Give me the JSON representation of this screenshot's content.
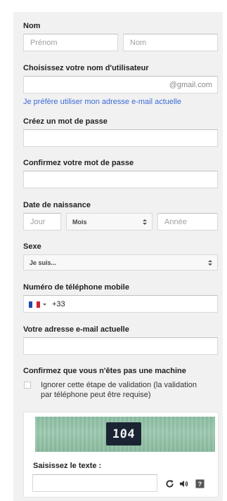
{
  "name": {
    "label": "Nom",
    "first_placeholder": "Prénom",
    "last_placeholder": "Nom"
  },
  "username": {
    "label": "Choisissez votre nom d'utilisateur",
    "suffix": "@gmail.com",
    "alt_link": "Je préfère utiliser mon adresse e-mail actuelle"
  },
  "password": {
    "label": "Créez un mot de passe"
  },
  "confirm_password": {
    "label": "Confirmez votre mot de passe"
  },
  "birthdate": {
    "label": "Date de naissance",
    "day_placeholder": "Jour",
    "month_value": "Mois",
    "year_placeholder": "Année"
  },
  "gender": {
    "label": "Sexe",
    "value": "Je suis..."
  },
  "phone": {
    "label": "Numéro de téléphone mobile",
    "country_code": "+33",
    "flag_colors": [
      "#1f4ba5",
      "#ffffff",
      "#d1242f"
    ]
  },
  "current_email": {
    "label": "Votre adresse e-mail actuelle"
  },
  "verify": {
    "label": "Confirmez que vous n'êtes pas une machine",
    "skip_line1": "Ignorer cette étape de validation (la validation",
    "skip_line2": "par téléphone peut être requise)",
    "skip_checked": false
  },
  "captcha": {
    "code": "104",
    "prompt": "Saisissez le texte :"
  },
  "colors": {
    "panel": "#f1f1f1",
    "link": "#3b6ad4",
    "captcha_bg": "#9ec9b0",
    "captcha_code_bg": "#1a2433"
  }
}
